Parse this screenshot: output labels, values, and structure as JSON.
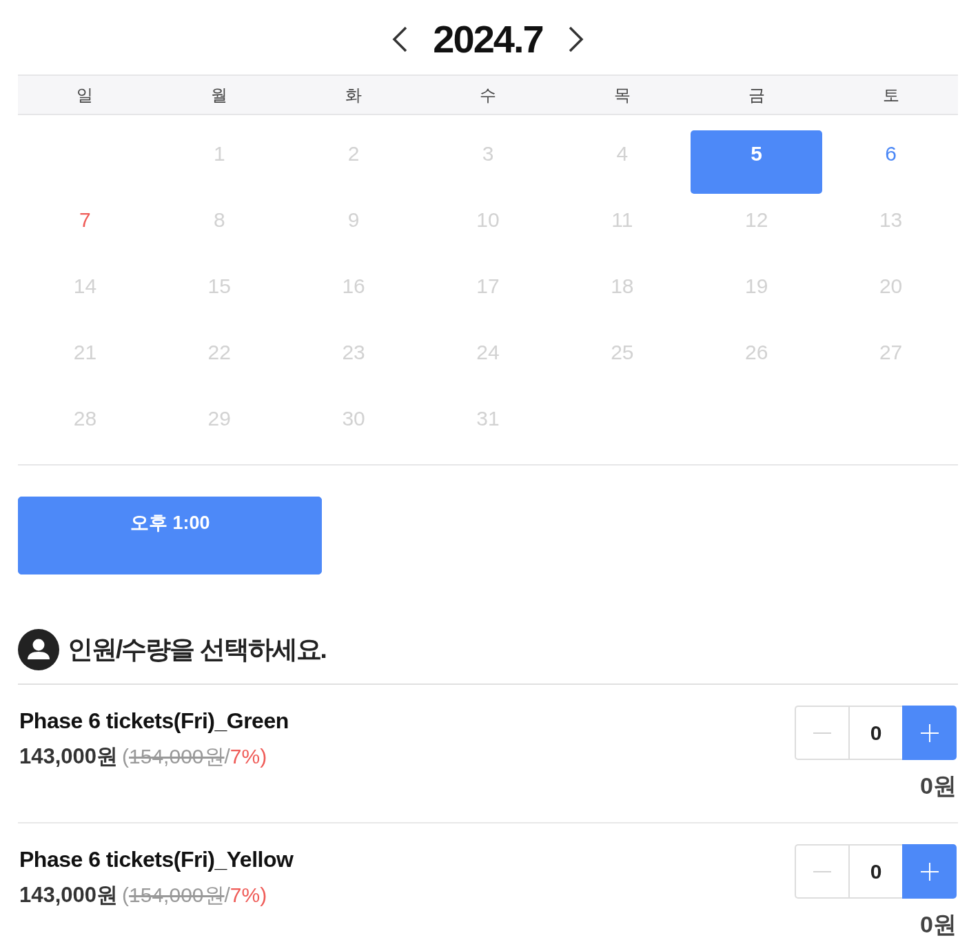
{
  "calendar": {
    "title": "2024.7",
    "weekdays": [
      "일",
      "월",
      "화",
      "수",
      "목",
      "금",
      "토"
    ],
    "weeks": [
      {
        "days": [
          {
            "kind": "blank"
          },
          {
            "kind": "day",
            "label": "1",
            "available": false,
            "selected": false
          },
          {
            "kind": "day",
            "label": "2",
            "available": false,
            "selected": false
          },
          {
            "kind": "day",
            "label": "3",
            "available": false,
            "selected": false
          },
          {
            "kind": "day",
            "label": "4",
            "available": false,
            "selected": false
          },
          {
            "kind": "day",
            "label": "5",
            "available": true,
            "selected": true
          },
          {
            "kind": "day",
            "label": "6",
            "available": true,
            "selected": false
          }
        ]
      },
      {
        "days": [
          {
            "kind": "day",
            "label": "7",
            "available": true,
            "selected": false
          },
          {
            "kind": "day",
            "label": "8",
            "available": false,
            "selected": false
          },
          {
            "kind": "day",
            "label": "9",
            "available": false,
            "selected": false
          },
          {
            "kind": "day",
            "label": "10",
            "available": false,
            "selected": false
          },
          {
            "kind": "day",
            "label": "11",
            "available": false,
            "selected": false
          },
          {
            "kind": "day",
            "label": "12",
            "available": false,
            "selected": false
          },
          {
            "kind": "day",
            "label": "13",
            "available": false,
            "selected": false
          }
        ]
      },
      {
        "days": [
          {
            "kind": "day",
            "label": "14",
            "available": false,
            "selected": false
          },
          {
            "kind": "day",
            "label": "15",
            "available": false,
            "selected": false
          },
          {
            "kind": "day",
            "label": "16",
            "available": false,
            "selected": false
          },
          {
            "kind": "day",
            "label": "17",
            "available": false,
            "selected": false
          },
          {
            "kind": "day",
            "label": "18",
            "available": false,
            "selected": false
          },
          {
            "kind": "day",
            "label": "19",
            "available": false,
            "selected": false
          },
          {
            "kind": "day",
            "label": "20",
            "available": false,
            "selected": false
          }
        ]
      },
      {
        "days": [
          {
            "kind": "day",
            "label": "21",
            "available": false,
            "selected": false
          },
          {
            "kind": "day",
            "label": "22",
            "available": false,
            "selected": false
          },
          {
            "kind": "day",
            "label": "23",
            "available": false,
            "selected": false
          },
          {
            "kind": "day",
            "label": "24",
            "available": false,
            "selected": false
          },
          {
            "kind": "day",
            "label": "25",
            "available": false,
            "selected": false
          },
          {
            "kind": "day",
            "label": "26",
            "available": false,
            "selected": false
          },
          {
            "kind": "day",
            "label": "27",
            "available": false,
            "selected": false
          }
        ]
      },
      {
        "days": [
          {
            "kind": "day",
            "label": "28",
            "available": false,
            "selected": false
          },
          {
            "kind": "day",
            "label": "29",
            "available": false,
            "selected": false
          },
          {
            "kind": "day",
            "label": "30",
            "available": false,
            "selected": false
          },
          {
            "kind": "day",
            "label": "31",
            "available": false,
            "selected": false
          }
        ]
      }
    ]
  },
  "time_slots": [
    {
      "label": "오후 1:00",
      "selected": true
    }
  ],
  "quantity_section": {
    "title": "인원/수량을 선택하세요.",
    "tickets": [
      {
        "name": "Phase 6 tickets(Fri)_Green",
        "price": "143,000원",
        "note_parts": [
          {
            "kind": "plain",
            "text": "("
          },
          {
            "kind": "struck",
            "text": "154,000원"
          },
          {
            "kind": "plain",
            "text": "/"
          },
          {
            "kind": "discount",
            "text": "7%)"
          }
        ],
        "quantity": "0",
        "decrease_disabled": true,
        "subtotal": "0원"
      },
      {
        "name": "Phase 6 tickets(Fri)_Yellow",
        "price": "143,000원",
        "note_parts": [
          {
            "kind": "plain",
            "text": "("
          },
          {
            "kind": "struck",
            "text": "154,000원"
          },
          {
            "kind": "plain",
            "text": "/"
          },
          {
            "kind": "discount",
            "text": "7%)"
          }
        ],
        "quantity": "0",
        "decrease_disabled": true,
        "subtotal": "0원"
      }
    ]
  }
}
